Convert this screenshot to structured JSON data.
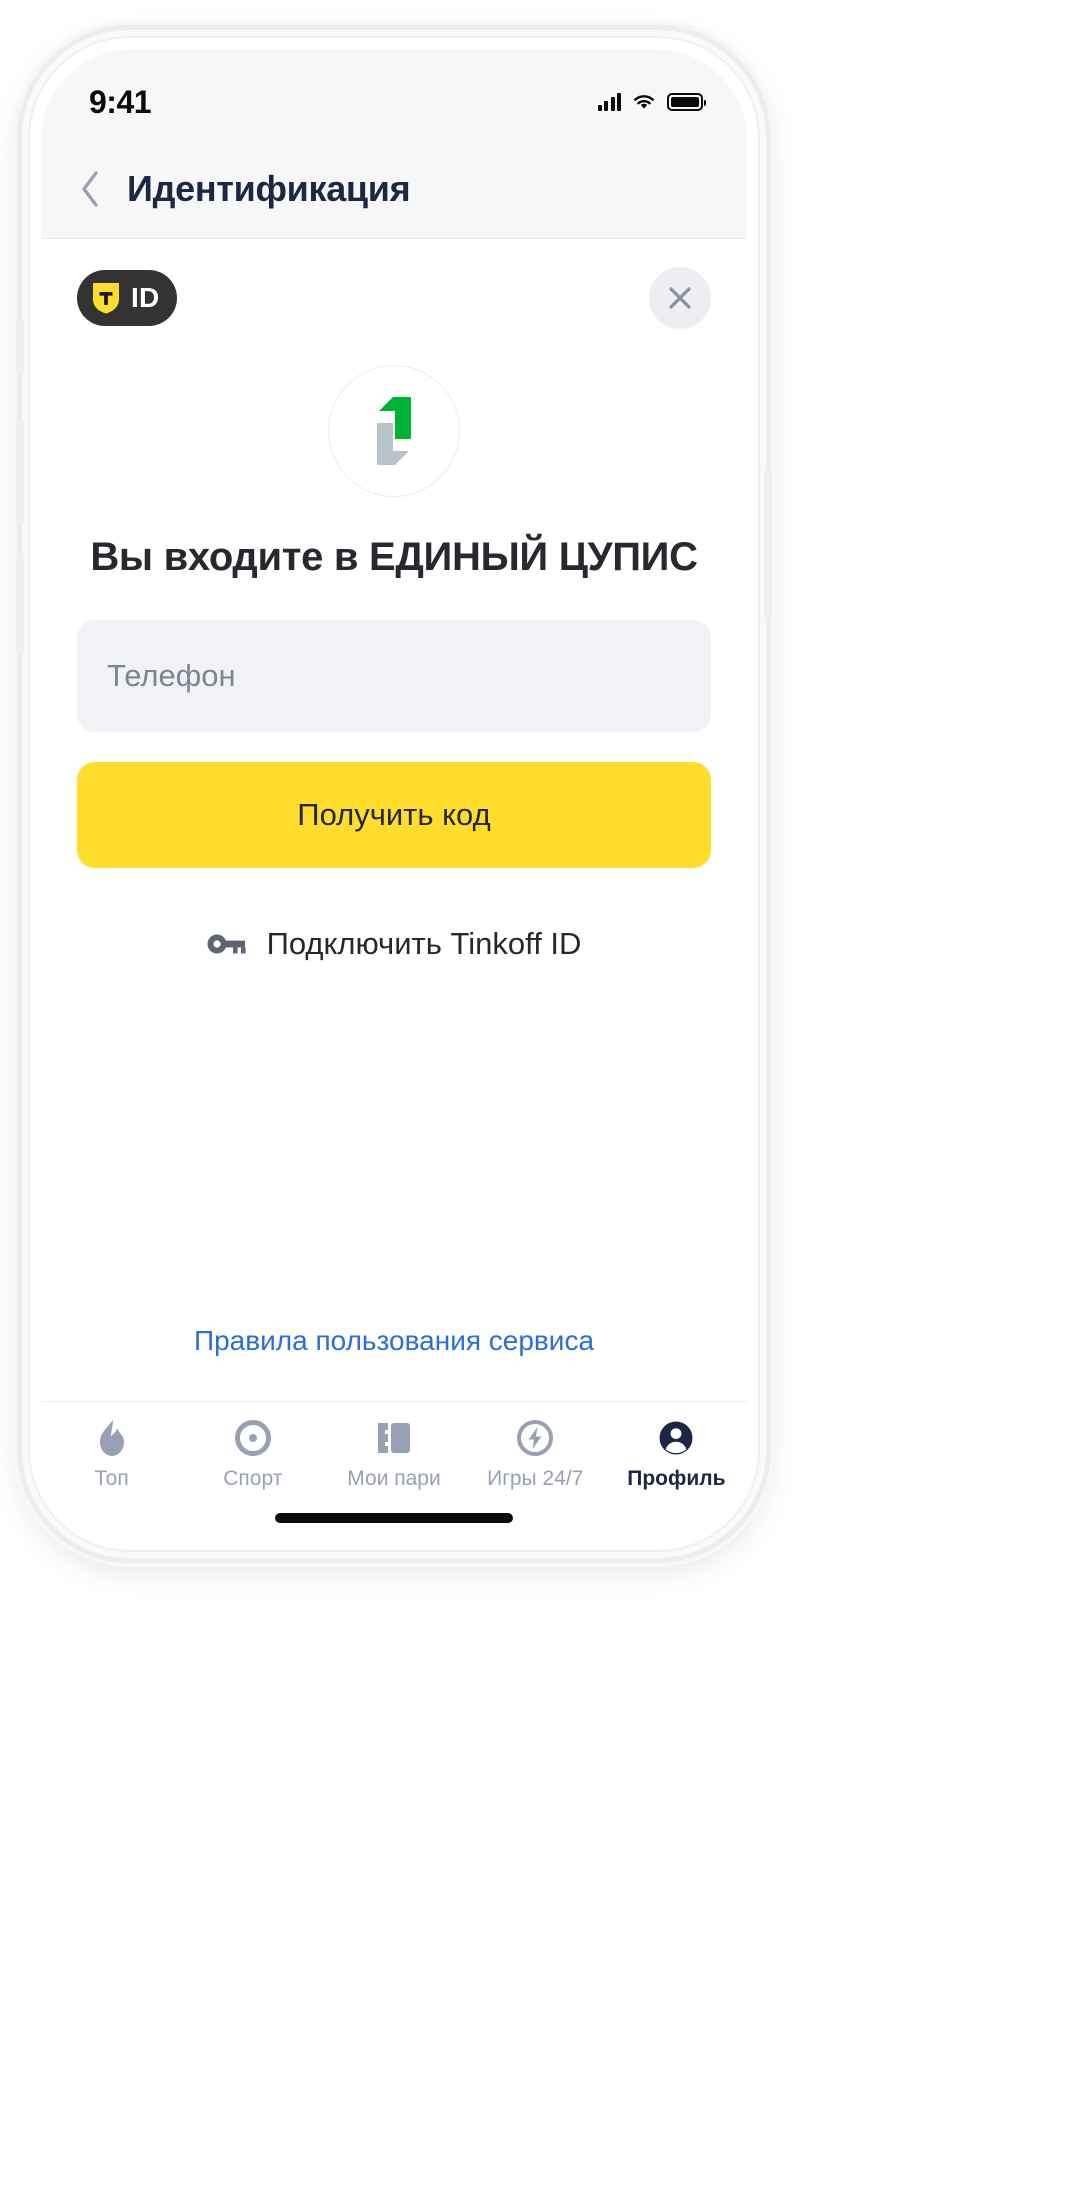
{
  "statusbar": {
    "time": "9:41",
    "signal_icon": "cellular-signal-icon",
    "wifi_icon": "wifi-icon",
    "battery_icon": "battery-full-icon"
  },
  "navbar": {
    "back_icon": "chevron-left-icon",
    "title": "Идентификация"
  },
  "sheet": {
    "brand_badge": {
      "shield_letter": "T",
      "id_label": "ID",
      "badge_bg": "#333333",
      "shield_color": "#ffdd2d"
    },
    "close_icon": "close-icon",
    "logo": {
      "name": "cupis-logo",
      "green": "#00b336",
      "gray": "#b6c4c9"
    },
    "heading": "Вы входите в ЕДИНЫЙ ЦУПИС",
    "phone_field": {
      "placeholder": "Телефон",
      "value": ""
    },
    "cta_label": "Получить код",
    "tinkoff_link": {
      "icon": "key-icon",
      "label": "Подключить Tinkoff ID"
    },
    "rules_link": "Правила пользования сервиса",
    "link_color": "#2b6ddd",
    "accent_color": "#ffdd2d"
  },
  "tabbar": {
    "items": [
      {
        "label": "Топ",
        "icon": "flame-icon",
        "active": false
      },
      {
        "label": "Спорт",
        "icon": "target-icon",
        "active": false
      },
      {
        "label": "Мои пари",
        "icon": "ticket-icon",
        "active": false
      },
      {
        "label": "Игры 24/7",
        "icon": "lightning-icon",
        "active": false
      },
      {
        "label": "Профиль",
        "icon": "person-icon",
        "active": true
      }
    ],
    "inactive_color": "#9aa0b4",
    "active_color": "#1d2642"
  }
}
